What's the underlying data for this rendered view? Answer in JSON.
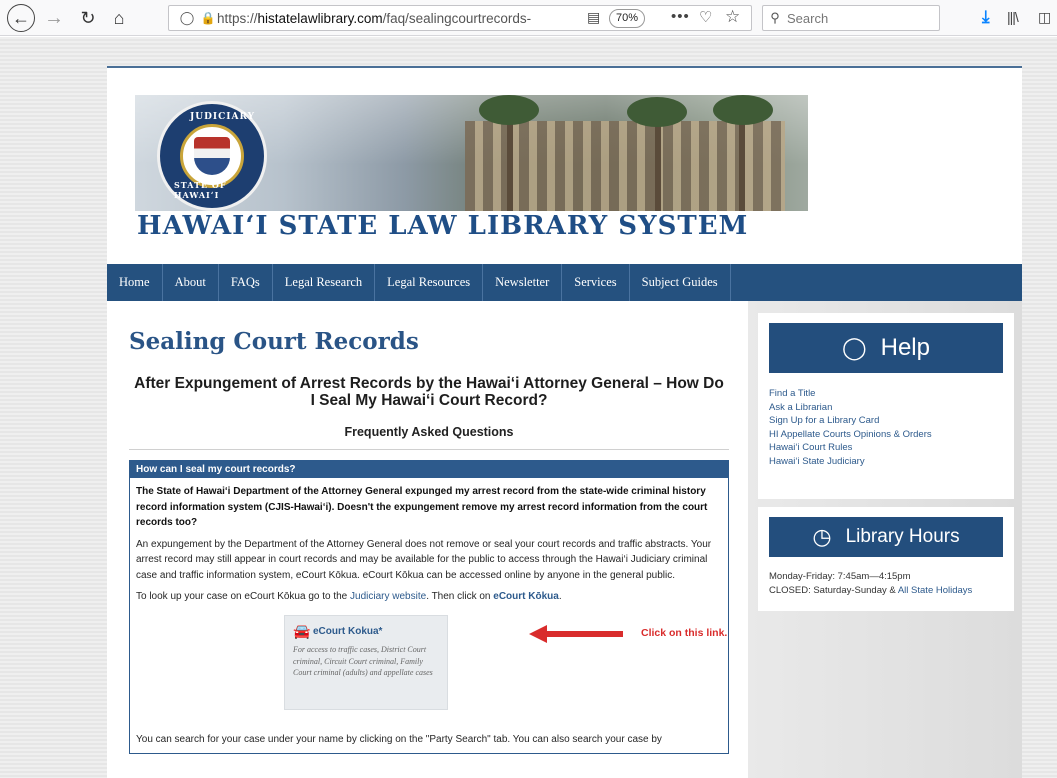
{
  "browser": {
    "url_prefix": "https://",
    "url_domain": "histatelawlibrary.com",
    "url_path": "/faq/sealingcourtrecords-",
    "zoom": "70%",
    "search_placeholder": "Search",
    "overflow_menu": "•••"
  },
  "site": {
    "title": "HAWAI‘I STATE LAW LIBRARY SYSTEM",
    "seal_top_text": "JUDICIARY",
    "seal_bottom_text": "STATE OF HAWAI‘I"
  },
  "nav": {
    "items": [
      "Home",
      "About",
      "FAQs",
      "Legal Research",
      "Legal Resources",
      "Newsletter",
      "Services",
      "Subject Guides"
    ]
  },
  "main": {
    "page_title": "Sealing Court Records",
    "subtitle": "After Expungement of Arrest Records by the Hawai‘i Attorney General – How Do I Seal My Hawai‘i Court Record?",
    "faq_label": "Frequently Asked Questions",
    "question_bar": "How can I seal my court records?",
    "question": "The State of Hawai‘i Department of the Attorney General expunged my arrest record from the state-wide criminal history record information system (CJIS-Hawai‘i). Doesn't the expungement remove my arrest record information from the court records too?",
    "answer": "An expungement by the Department of the Attorney General does not remove or seal your court records and traffic abstracts. Your arrest record may still appear in court records and may be available for the public to access through the Hawai‘i Judiciary criminal case and traffic information system, eCourt Kōkua. eCourt Kōkua can be accessed online by anyone in the general public.",
    "lookup_pre": "To look up your case on eCourt Kōkua go to the ",
    "lookup_link": "Judiciary website",
    "lookup_mid": ". Then click on ",
    "lookup_link2": "eCourt Kōkua",
    "lookup_end": ".",
    "ecourt_title": "eCourt Kokua*",
    "ecourt_desc": "For access to traffic cases, District Court criminal, Circuit Court criminal, Family Court criminal (adults) and appellate cases",
    "click_label": "Click on this link.",
    "search_text": "You can search for your case under your name by clicking on the \"Party Search\" tab. You can also search your case by"
  },
  "sidebar": {
    "help_title": "Help",
    "help_links": [
      "Find a Title",
      "Ask a Librarian",
      "Sign Up for a Library Card",
      "HI Appellate Courts Opinions & Orders",
      "Hawai‘i Court Rules",
      "Hawai‘i State Judiciary"
    ],
    "hours_title": "Library Hours",
    "hours_line1": "Monday-Friday: 7:45am—4:15pm",
    "hours_line2_pre": "CLOSED: Saturday-Sunday & ",
    "hours_link": "All State Holidays"
  },
  "colors": {
    "brand_blue": "#25517f",
    "accent_red": "#d92c2c"
  }
}
